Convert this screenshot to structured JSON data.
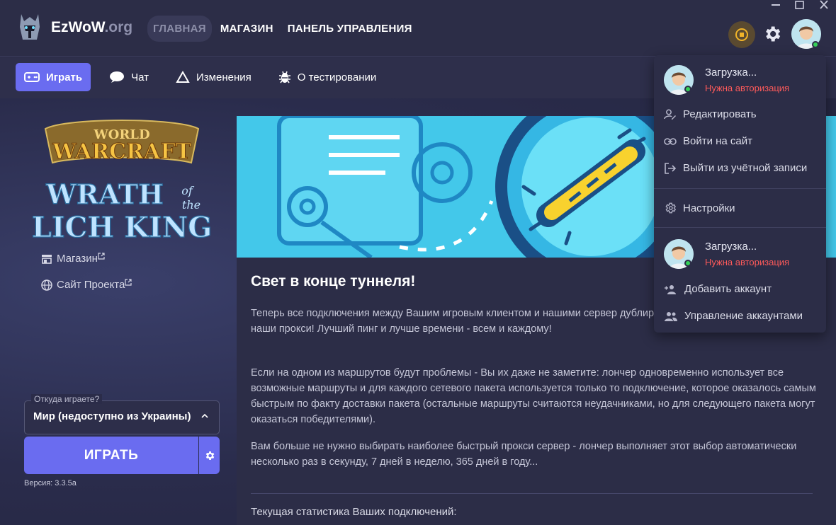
{
  "header": {
    "brand_name": "EzWoW",
    "brand_suffix": ".org",
    "nav": [
      {
        "label": "ГЛАВНАЯ",
        "active": true
      },
      {
        "label": "МАГАЗИН",
        "active": false
      },
      {
        "label": "ПАНЕЛЬ УПРАВЛЕНИЯ",
        "active": false
      }
    ],
    "status_color": "#f0b429"
  },
  "tabs": [
    {
      "label": "Играть",
      "icon": "gamepad-icon",
      "active": true
    },
    {
      "label": "Чат",
      "icon": "chat-bubble-icon",
      "active": false
    },
    {
      "label": "Изменения",
      "icon": "triangle-icon",
      "active": false
    },
    {
      "label": "О тестировании",
      "icon": "bug-icon",
      "active": false
    }
  ],
  "left": {
    "links": [
      {
        "label": "Магазин",
        "icon": "store-icon"
      },
      {
        "label": "Сайт Проекта",
        "icon": "globe-icon"
      }
    ],
    "region_label": "Откуда играете?",
    "region_value": "Мир (недоступно из Украины)",
    "play_label": "ИГРАТЬ",
    "version": "Версия: 3.3.5a"
  },
  "news": {
    "title": "Свет в конце туннеля!",
    "paragraphs": [
      "Теперь все подключения между Вашим игровым клиентом и нашими сервер дублирование - одновременно через все наши прокси! Лучший пинг и лучше времени - всем и каждому!",
      "Если на одном из маршрутов будут проблемы - Вы их даже не заметите: лончер одновременно использует все возможные маршруты и для каждого сетевого пакета используется только то подключение, которое оказалось самым быстрым по факту доставки пакета (остальные маршруты считаются неудачниками, но для следующего пакета могут оказаться победителями).",
      "Вам больше не нужно выбирать наиболее быстрый прокси сервер - лончер выполняет этот выбор автоматически несколько раз в секунду, 7 дней в неделю, 365 дней в году..."
    ],
    "stats_label": "Текущая статистика Ваших подключений:"
  },
  "menu": {
    "accounts": [
      {
        "name": "Загрузка...",
        "status": "Нужна авторизация"
      },
      {
        "name": "Загрузка...",
        "status": "Нужна авторизация"
      }
    ],
    "edit": "Редактировать",
    "login_site": "Войти на сайт",
    "logout": "Выйти из учётной записи",
    "settings": "Настройки",
    "add_account": "Добавить аккаунт",
    "manage_accounts": "Управление аккаунтами"
  },
  "colors": {
    "accent": "#6a6cf0",
    "background": "#2b2c46",
    "error": "#ff5a5a",
    "online": "#34d058"
  }
}
